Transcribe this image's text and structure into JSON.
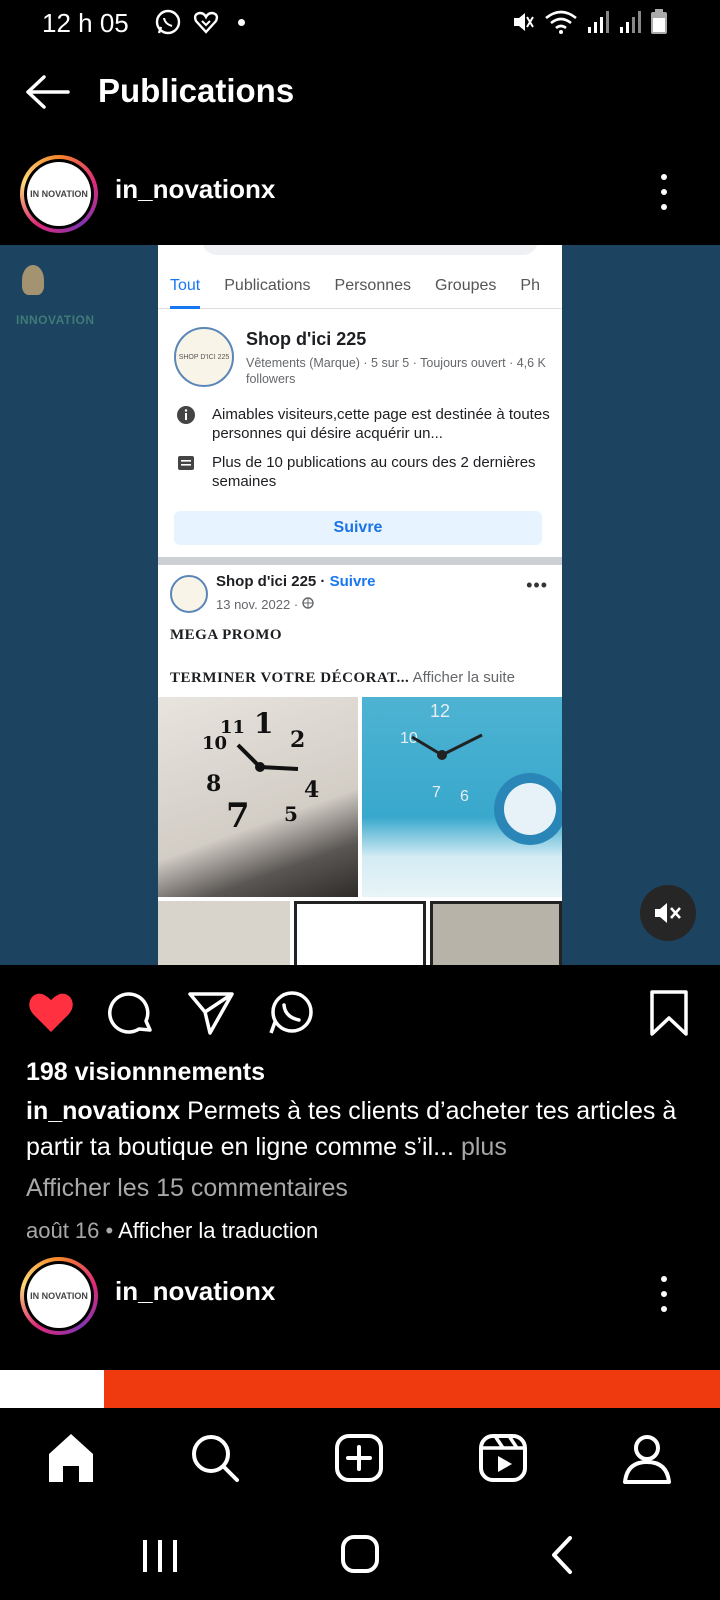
{
  "status_bar": {
    "time": "12 h 05"
  },
  "header": {
    "title": "Publications"
  },
  "post": {
    "username": "in_novationx",
    "avatar_text": "IN NOVATION",
    "media": {
      "brand_logo_text": "INNOVATION",
      "facebook_screenshot": {
        "tabs": [
          "Tout",
          "Publications",
          "Personnes",
          "Groupes",
          "Ph"
        ],
        "page_name": "Shop d'ici 225",
        "page_meta": "Vêtements (Marque) · 5 sur 5 · Toujours ouvert · 4,6 K followers",
        "info_about": "Aimables visiteurs,cette page est destinée à toutes personnes qui désire acquérir un...",
        "info_posts": "Plus de 10 publications au cours des 2 dernières semaines",
        "follow_button": "Suivre",
        "post_author": "Shop d'ici 225",
        "post_follow": "Suivre",
        "post_date": "13 nov. 2022 ·",
        "promo_line1": "MEGA PROMO",
        "promo_line2": "TERMINER VOTRE DÉCORAT...",
        "show_more": "Afficher la suite",
        "page_avatar_text": "SHOP D'ICI 225"
      }
    },
    "views": "198 visionnnements",
    "caption_text": "Permets à tes clients d’acheter tes articles à partir ta boutique en ligne comme s’il...",
    "caption_more": "plus",
    "comments_link": "Afficher les 15 commentaires",
    "date": "août 16",
    "translate_link": "Afficher la traduction",
    "liked": true
  },
  "next_post": {
    "username": "in_novationx"
  },
  "colors": {
    "like_red": "#ff3040",
    "media_bg": "#1c435f",
    "next_media_orange": "#ef3a0f"
  }
}
